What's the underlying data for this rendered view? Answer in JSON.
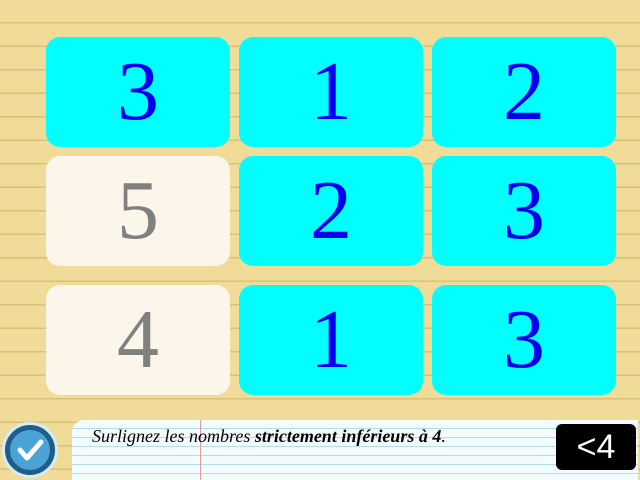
{
  "grid": {
    "cells": [
      {
        "value": "3",
        "state": "on"
      },
      {
        "value": "1",
        "state": "on"
      },
      {
        "value": "2",
        "state": "on"
      },
      {
        "value": "5",
        "state": "off"
      },
      {
        "value": "2",
        "state": "on"
      },
      {
        "value": "3",
        "state": "on"
      },
      {
        "value": "4",
        "state": "off"
      },
      {
        "value": "1",
        "state": "on"
      },
      {
        "value": "3",
        "state": "on"
      }
    ]
  },
  "instruction": {
    "prefix": "Surlignez les nombres ",
    "bold": "strictement inférieurs à 4",
    "suffix": "."
  },
  "badge": {
    "label": "<4"
  },
  "colors": {
    "highlight_bg": "#00ffff",
    "highlight_text": "#0000ee",
    "plain_bg": "#fbf6e9",
    "plain_text": "#808080",
    "page_bg": "#f0dc98"
  },
  "icons": {
    "submit": "check-icon"
  }
}
